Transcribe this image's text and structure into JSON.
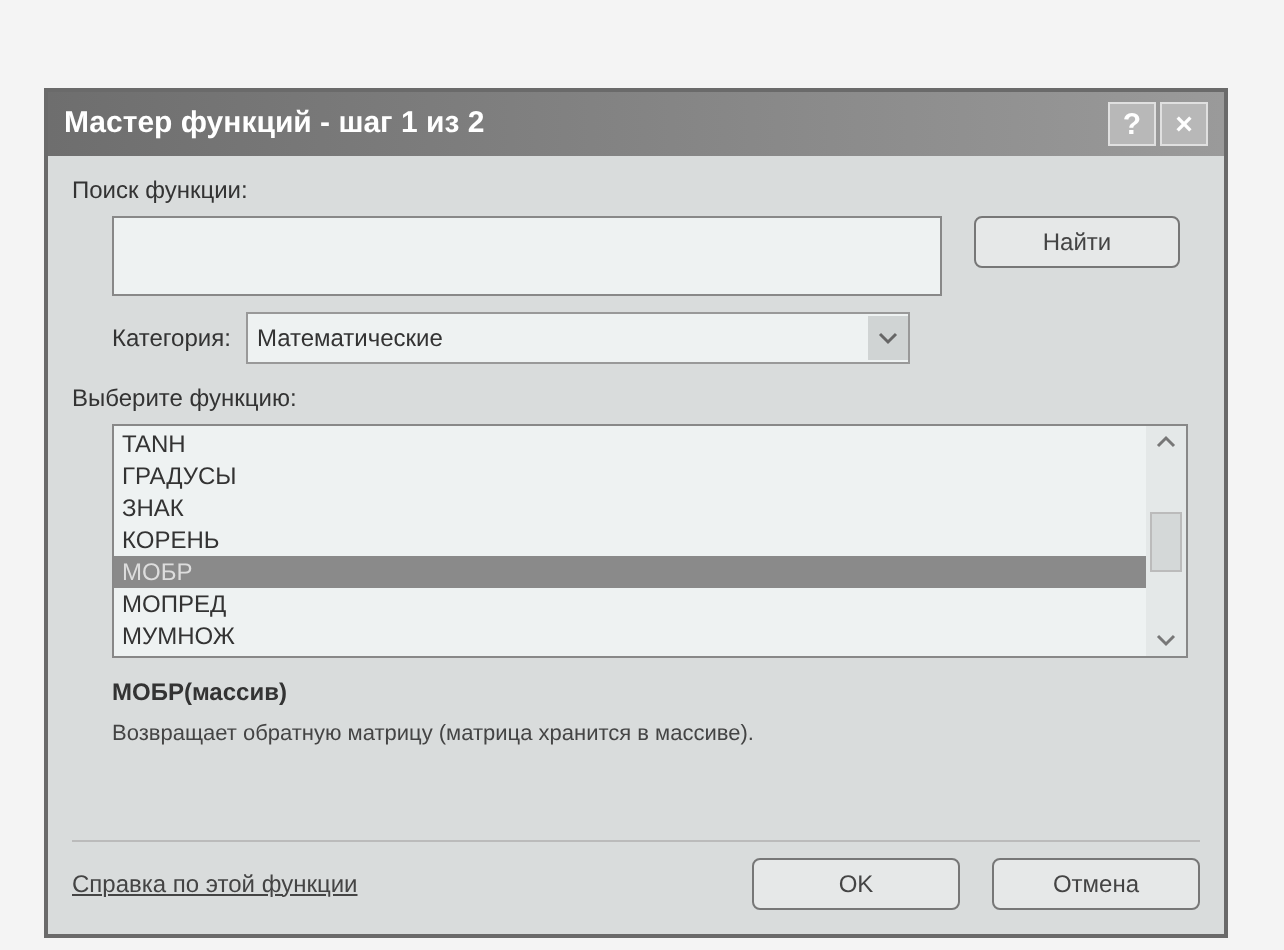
{
  "window": {
    "title": "Мастер функций - шаг 1 из 2",
    "controls": [
      "?",
      "×"
    ]
  },
  "search": {
    "label": "Поиск функции:",
    "button": "Найти"
  },
  "category": {
    "label": "Категория:",
    "value": "Математические"
  },
  "list": {
    "label": "Выберите функцию:",
    "items": [
      {
        "name": "TANH",
        "selected": false
      },
      {
        "name": "ГРАДУСЫ",
        "selected": false
      },
      {
        "name": "ЗНАК",
        "selected": false
      },
      {
        "name": "КОРЕНЬ",
        "selected": false
      },
      {
        "name": "МОБР",
        "selected": true
      },
      {
        "name": "МОПРЕД",
        "selected": false
      },
      {
        "name": "МУМНОЖ",
        "selected": false
      }
    ]
  },
  "signature": "МОБР(массив)",
  "description": "Возвращает обратную матрицу (матрица хранится в массиве).",
  "help_link": "Справка по этой функции",
  "buttons": [
    "OK",
    "Отмена"
  ]
}
